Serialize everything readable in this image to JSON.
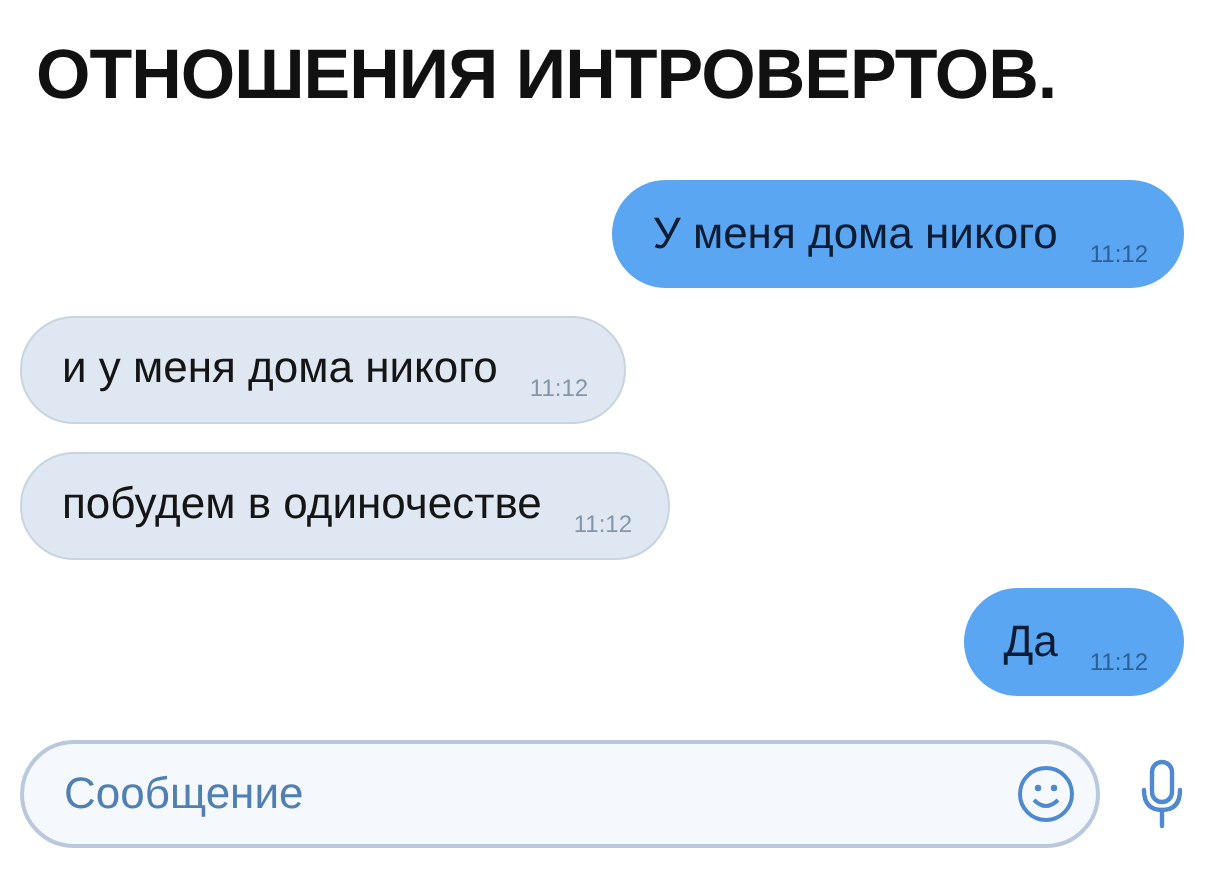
{
  "caption": "ОТНОШЕНИЯ ИНТРОВЕРТОВ.",
  "messages": [
    {
      "kind": "outgoing",
      "text": "У меня дома никого",
      "time": "11:12"
    },
    {
      "kind": "incoming",
      "text": "и у меня дома никого",
      "time": "11:12"
    },
    {
      "kind": "incoming",
      "text": "побудем в одиночестве",
      "time": "11:12"
    },
    {
      "kind": "outgoing",
      "text": "Да",
      "time": "11:12"
    }
  ],
  "composer": {
    "placeholder": "Сообщение"
  }
}
